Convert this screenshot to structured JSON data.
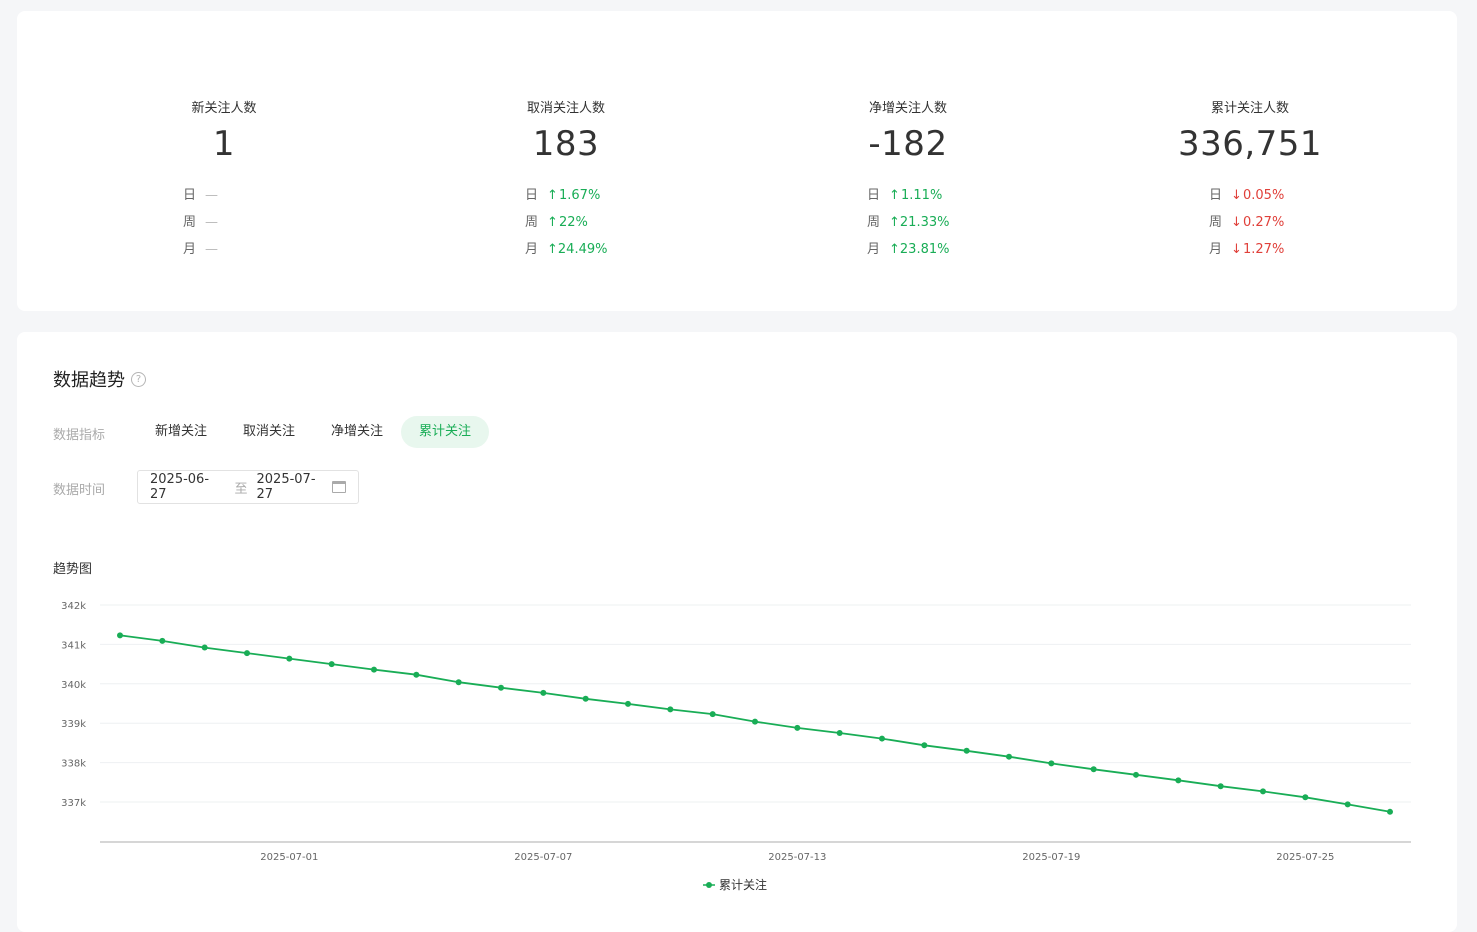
{
  "stats": [
    {
      "label": "新关注人数",
      "value": "1",
      "rows": [
        {
          "period": "日",
          "dir": "flat",
          "text": "—"
        },
        {
          "period": "周",
          "dir": "flat",
          "text": "—"
        },
        {
          "period": "月",
          "dir": "flat",
          "text": "—"
        }
      ]
    },
    {
      "label": "取消关注人数",
      "value": "183",
      "rows": [
        {
          "period": "日",
          "dir": "up",
          "text": "1.67%"
        },
        {
          "period": "周",
          "dir": "up",
          "text": "22%"
        },
        {
          "period": "月",
          "dir": "up",
          "text": "24.49%"
        }
      ]
    },
    {
      "label": "净增关注人数",
      "value": "-182",
      "rows": [
        {
          "period": "日",
          "dir": "up",
          "text": "1.11%"
        },
        {
          "period": "周",
          "dir": "up",
          "text": "21.33%"
        },
        {
          "period": "月",
          "dir": "up",
          "text": "23.81%"
        }
      ]
    },
    {
      "label": "累计关注人数",
      "value": "336,751",
      "rows": [
        {
          "period": "日",
          "dir": "down",
          "text": "0.05%"
        },
        {
          "period": "周",
          "dir": "down",
          "text": "0.27%"
        },
        {
          "period": "月",
          "dir": "down",
          "text": "1.27%"
        }
      ]
    }
  ],
  "trend": {
    "title": "数据趋势",
    "metric_label": "数据指标",
    "tabs": [
      "新增关注",
      "取消关注",
      "净增关注",
      "累计关注"
    ],
    "active_tab": 3,
    "time_label": "数据时间",
    "date_start": "2025-06-27",
    "date_sep": "至",
    "date_end": "2025-07-27",
    "chart_title": "趋势图"
  },
  "colors": {
    "accent": "#19ad56",
    "down": "#e0403a"
  },
  "chart_data": {
    "type": "line",
    "x": [
      "2025-06-27",
      "2025-06-28",
      "2025-06-29",
      "2025-06-30",
      "2025-07-01",
      "2025-07-02",
      "2025-07-03",
      "2025-07-04",
      "2025-07-05",
      "2025-07-06",
      "2025-07-07",
      "2025-07-08",
      "2025-07-09",
      "2025-07-10",
      "2025-07-11",
      "2025-07-12",
      "2025-07-13",
      "2025-07-14",
      "2025-07-15",
      "2025-07-16",
      "2025-07-17",
      "2025-07-18",
      "2025-07-19",
      "2025-07-20",
      "2025-07-21",
      "2025-07-22",
      "2025-07-23",
      "2025-07-24",
      "2025-07-25",
      "2025-07-26",
      "2025-07-27"
    ],
    "x_ticks": [
      "2025-07-01",
      "2025-07-07",
      "2025-07-13",
      "2025-07-19",
      "2025-07-25"
    ],
    "series": [
      {
        "name": "累计关注",
        "values": [
          341230,
          341090,
          340920,
          340780,
          340640,
          340500,
          340360,
          340230,
          340040,
          339900,
          339770,
          339620,
          339490,
          339350,
          339230,
          339040,
          338880,
          338750,
          338610,
          338440,
          338300,
          338150,
          337980,
          337830,
          337690,
          337550,
          337400,
          337270,
          337120,
          336940,
          336751
        ]
      }
    ],
    "y_ticks": [
      "342k",
      "341k",
      "340k",
      "339k",
      "338k",
      "337k"
    ],
    "ylim": [
      336000,
      342000
    ],
    "grid": true,
    "legend": "bottom"
  }
}
